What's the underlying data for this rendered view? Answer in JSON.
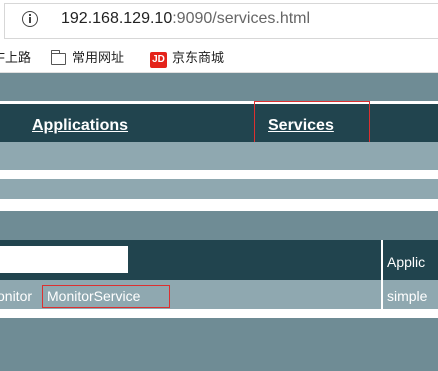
{
  "browser": {
    "url_host": "192.168.129.10",
    "url_rest": ":9090/services.html",
    "bookmarks": [
      {
        "label": "F上路",
        "icon": ""
      },
      {
        "label": "常用网址",
        "icon": "folder-icon"
      },
      {
        "label": "京东商城",
        "icon": "jd-icon",
        "badge": "JD"
      }
    ]
  },
  "nav": {
    "applications_label": "Applications",
    "services_label": "Services"
  },
  "table": {
    "header_partial": "Applic",
    "row": {
      "app_partial": "onitor",
      "service": "MonitorService",
      "app_col_partial": "simple"
    }
  },
  "colors": {
    "band_dark": "#6f8c95",
    "band_light": "#8fa8b0",
    "nav_bar": "#21444e",
    "highlight": "#dd3030"
  }
}
